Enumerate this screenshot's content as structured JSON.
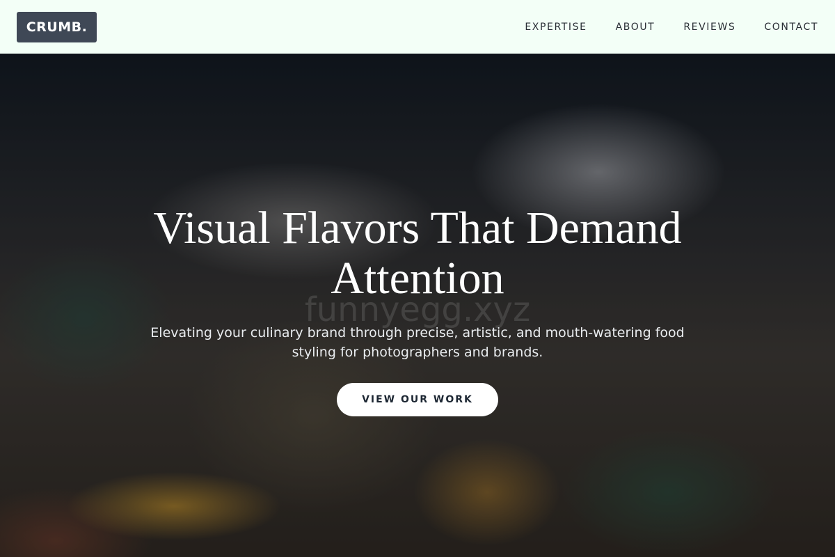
{
  "header": {
    "logo": "CRUMB.",
    "nav": [
      {
        "label": "EXPERTISE"
      },
      {
        "label": "ABOUT"
      },
      {
        "label": "REVIEWS"
      },
      {
        "label": "CONTACT"
      }
    ]
  },
  "hero": {
    "title": "Visual Flavors That Demand Attention",
    "subtitle": "Elevating your culinary brand through precise, artistic, and mouth-watering food styling for photographers and brands.",
    "cta_label": "VIEW OUR WORK",
    "watermark": "funnyegg.xyz"
  },
  "colors": {
    "header_bg": "#f3fff7",
    "logo_bg": "#3f4856",
    "button_bg": "#ffffff",
    "button_text": "#1d2733"
  }
}
